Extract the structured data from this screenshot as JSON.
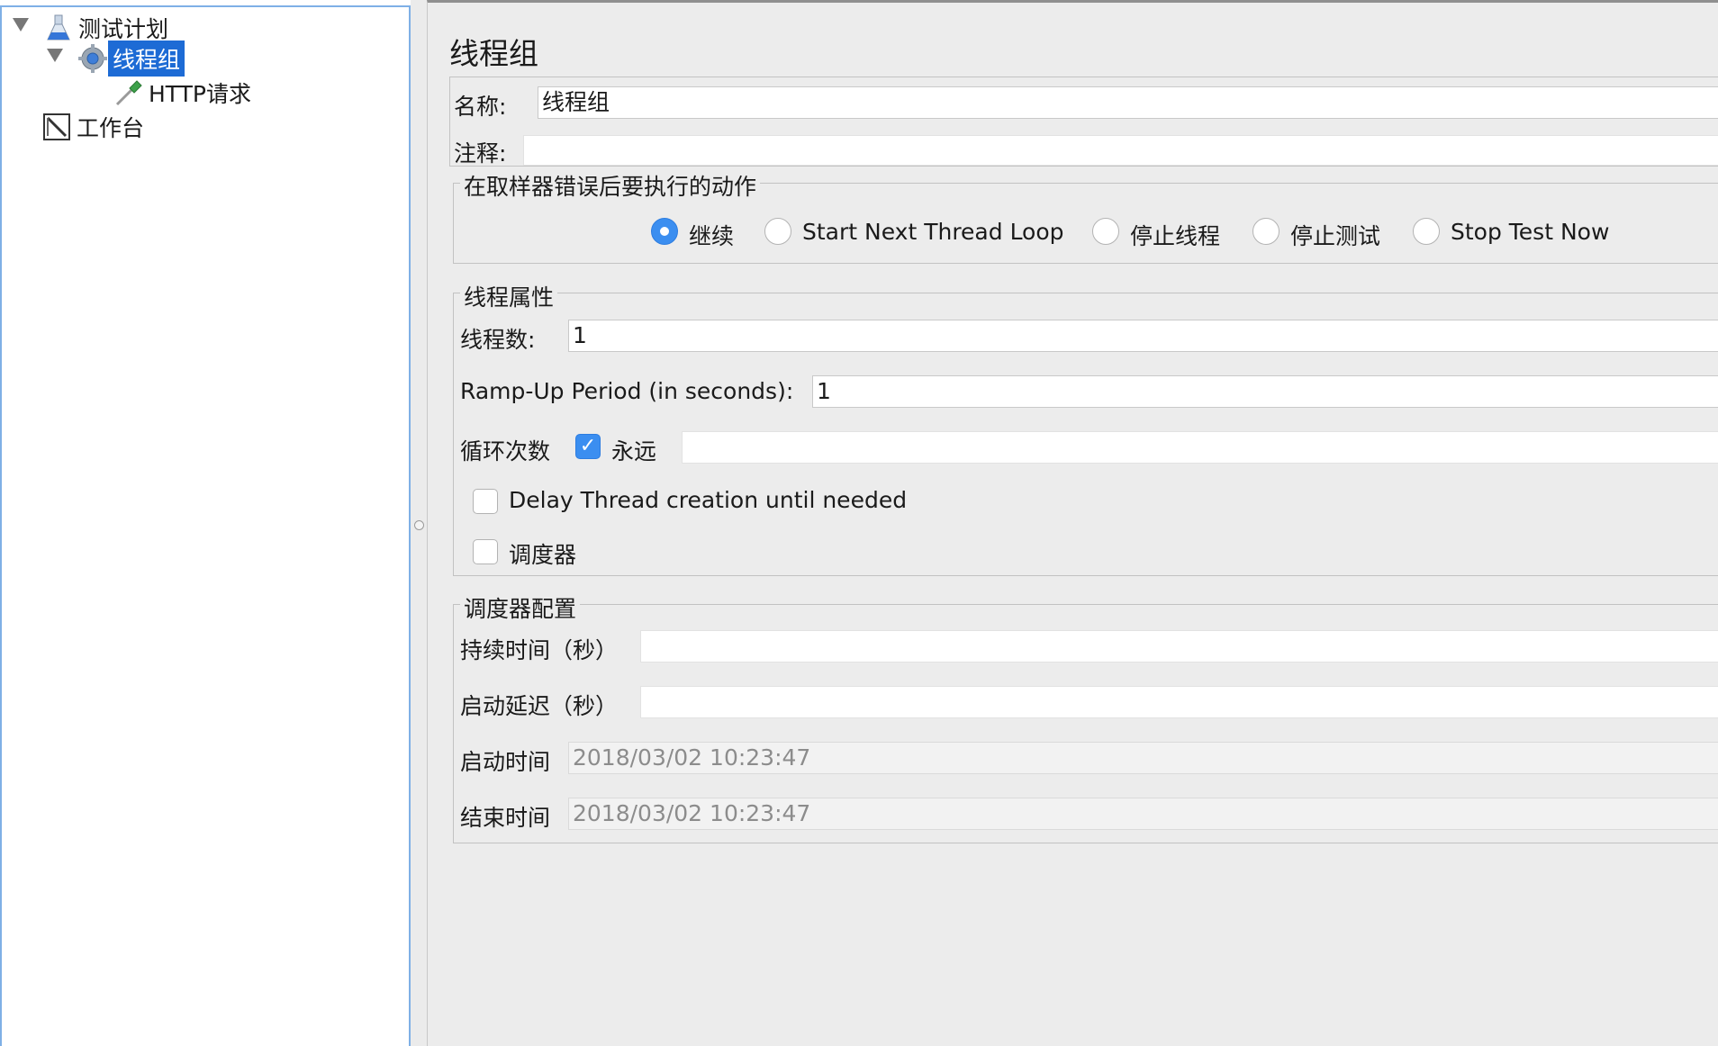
{
  "tree": {
    "items": [
      {
        "label": "测试计划",
        "icon": "flask-icon",
        "expanded": true
      },
      {
        "label": "线程组",
        "icon": "gear-icon",
        "expanded": true,
        "selected": true
      },
      {
        "label": "HTTP请求",
        "icon": "dropper-icon"
      },
      {
        "label": "工作台",
        "icon": "workbench-icon"
      }
    ]
  },
  "editor": {
    "title": "线程组",
    "name_label": "名称:",
    "name_value": "线程组",
    "comment_label": "注释:",
    "comment_value": "",
    "error_action": {
      "legend": "在取样器错误后要执行的动作",
      "options": [
        "继续",
        "Start Next Thread Loop",
        "停止线程",
        "停止测试",
        "Stop Test Now"
      ],
      "selected": "继续"
    },
    "thread_props": {
      "legend": "线程属性",
      "threads_label": "线程数:",
      "threads_value": "1",
      "rampup_label": "Ramp-Up Period (in seconds):",
      "rampup_value": "1",
      "loop_label": "循环次数",
      "forever_label": "永远",
      "forever_checked": true,
      "loop_value": "",
      "delay_label": "Delay Thread creation until needed",
      "delay_checked": false,
      "scheduler_label": "调度器",
      "scheduler_checked": false
    },
    "scheduler_config": {
      "legend": "调度器配置",
      "duration_label": "持续时间（秒）",
      "duration_value": "",
      "delay_label": "启动延迟（秒）",
      "delay_value": "",
      "start_label": "启动时间",
      "start_value": "2018/03/02 10:23:47",
      "end_label": "结束时间",
      "end_value": "2018/03/02 10:23:47"
    }
  },
  "colors": {
    "selection": "#1d6bd5",
    "accent": "#3b8ef0",
    "panel_bg": "#ececec"
  }
}
